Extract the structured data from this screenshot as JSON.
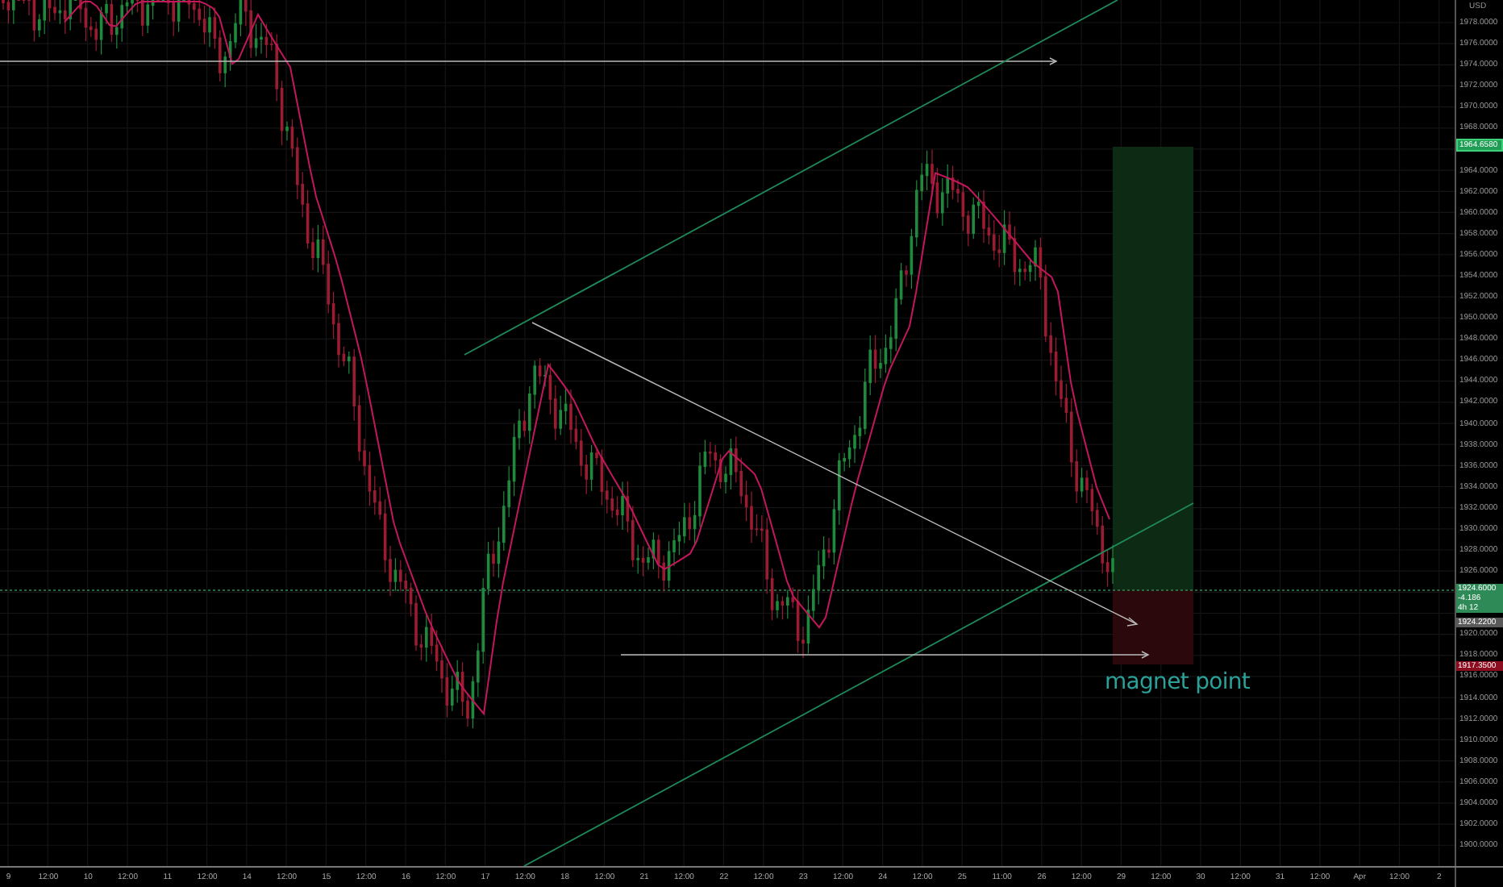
{
  "price_axis": {
    "unit": "USD",
    "upper_labels": [
      "1978.0000",
      "1976.0000",
      "1974.0000",
      "1972.0000",
      "1970.0000",
      "1968.0000"
    ],
    "middle_labels": [
      "1964.0000",
      "1962.0000",
      "1960.0000",
      "1958.0000",
      "1956.0000",
      "1954.0000",
      "1952.0000",
      "1950.0000",
      "1948.0000",
      "1946.0000",
      "1944.0000",
      "1942.0000",
      "1940.0000",
      "1938.0000",
      "1936.0000",
      "1934.0000",
      "1932.0000",
      "1930.0000",
      "1928.0000",
      "1926.0000"
    ],
    "lower_labels": [
      "1920.0000",
      "1918.0000",
      "1916.0000",
      "1914.0000",
      "1912.0000",
      "1910.0000",
      "1908.0000",
      "1906.0000",
      "1904.0000",
      "1902.0000",
      "1900.0000"
    ]
  },
  "price_markers": [
    {
      "kind": "target",
      "lines": [
        "1964.6580"
      ]
    },
    {
      "kind": "current",
      "lines": [
        "1924.6000",
        "-4.186",
        "4h 12"
      ]
    },
    {
      "kind": "entry",
      "lines": [
        "1924.2200"
      ]
    },
    {
      "kind": "stop",
      "lines": [
        "1917.3500"
      ]
    }
  ],
  "time_axis": {
    "labels": [
      "9",
      "12:00",
      "10",
      "12:00",
      "11",
      "12:00",
      "14",
      "12:00",
      "15",
      "12:00",
      "16",
      "12:00",
      "17",
      "12:00",
      "18",
      "12:00",
      "21",
      "12:00",
      "22",
      "12:00",
      "23",
      "12:00",
      "24",
      "12:00",
      "25",
      "11:00",
      "26",
      "12:00",
      "29",
      "12:00",
      "30",
      "12:00",
      "31",
      "12:00",
      "Apr",
      "12:00",
      "2"
    ]
  },
  "annotation": {
    "text": "magnet point"
  }
}
